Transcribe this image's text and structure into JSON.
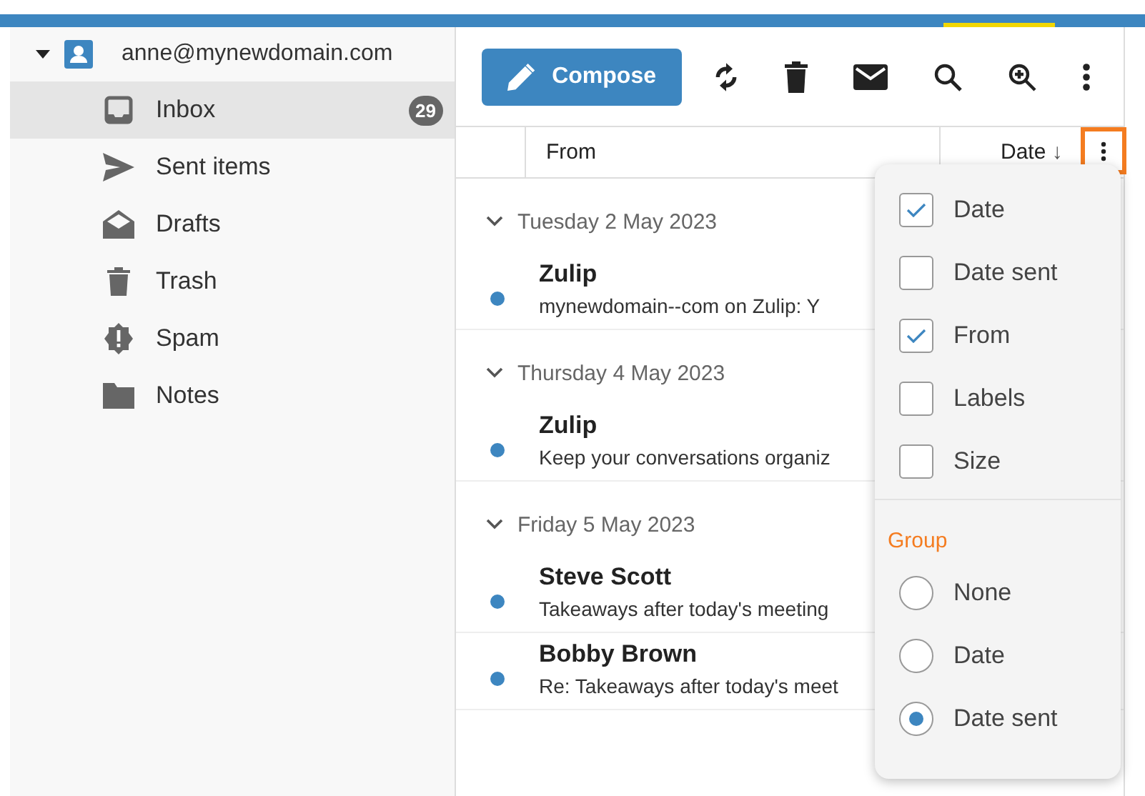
{
  "account": {
    "email": "anne@mynewdomain.com",
    "expanded": true
  },
  "folders": [
    {
      "kind": "inbox",
      "label": "Inbox",
      "count": "29",
      "selected": true
    },
    {
      "kind": "sent",
      "label": "Sent items",
      "selected": false
    },
    {
      "kind": "drafts",
      "label": "Drafts",
      "selected": false
    },
    {
      "kind": "trash",
      "label": "Trash",
      "selected": false
    },
    {
      "kind": "spam",
      "label": "Spam",
      "selected": false
    },
    {
      "kind": "notes",
      "label": "Notes",
      "selected": false
    }
  ],
  "toolbar": {
    "compose": "Compose",
    "tools": [
      {
        "kind": "refresh"
      },
      {
        "kind": "delete"
      },
      {
        "kind": "mail"
      },
      {
        "kind": "search"
      },
      {
        "kind": "zoom"
      },
      {
        "kind": "more"
      }
    ]
  },
  "columns": {
    "from": "From",
    "date": "Date",
    "sort_arrow": "↓"
  },
  "groups": [
    {
      "title": "Tuesday 2 May 2023",
      "messages": [
        {
          "from": "Zulip",
          "subject": "mynewdomain--com on Zulip: Y",
          "unread": true
        }
      ]
    },
    {
      "title": "Thursday 4 May 2023",
      "messages": [
        {
          "from": "Zulip",
          "subject": "Keep your conversations organiz",
          "unread": true
        }
      ]
    },
    {
      "title": "Friday 5 May 2023",
      "messages": [
        {
          "from": "Steve Scott",
          "subject": "Takeaways after today's meeting",
          "unread": true
        },
        {
          "from": "Bobby Brown",
          "subject": "Re: Takeaways after today's meet",
          "unread": true
        }
      ]
    }
  ],
  "column_menu": {
    "columns": [
      {
        "label": "Date",
        "checked": true
      },
      {
        "label": "Date sent",
        "checked": false
      },
      {
        "label": "From",
        "checked": true
      },
      {
        "label": "Labels",
        "checked": false
      },
      {
        "label": "Size",
        "checked": false
      }
    ],
    "group_title": "Group",
    "group_options": [
      {
        "label": "None",
        "selected": false
      },
      {
        "label": "Date",
        "selected": false
      },
      {
        "label": "Date sent",
        "selected": true
      }
    ]
  }
}
